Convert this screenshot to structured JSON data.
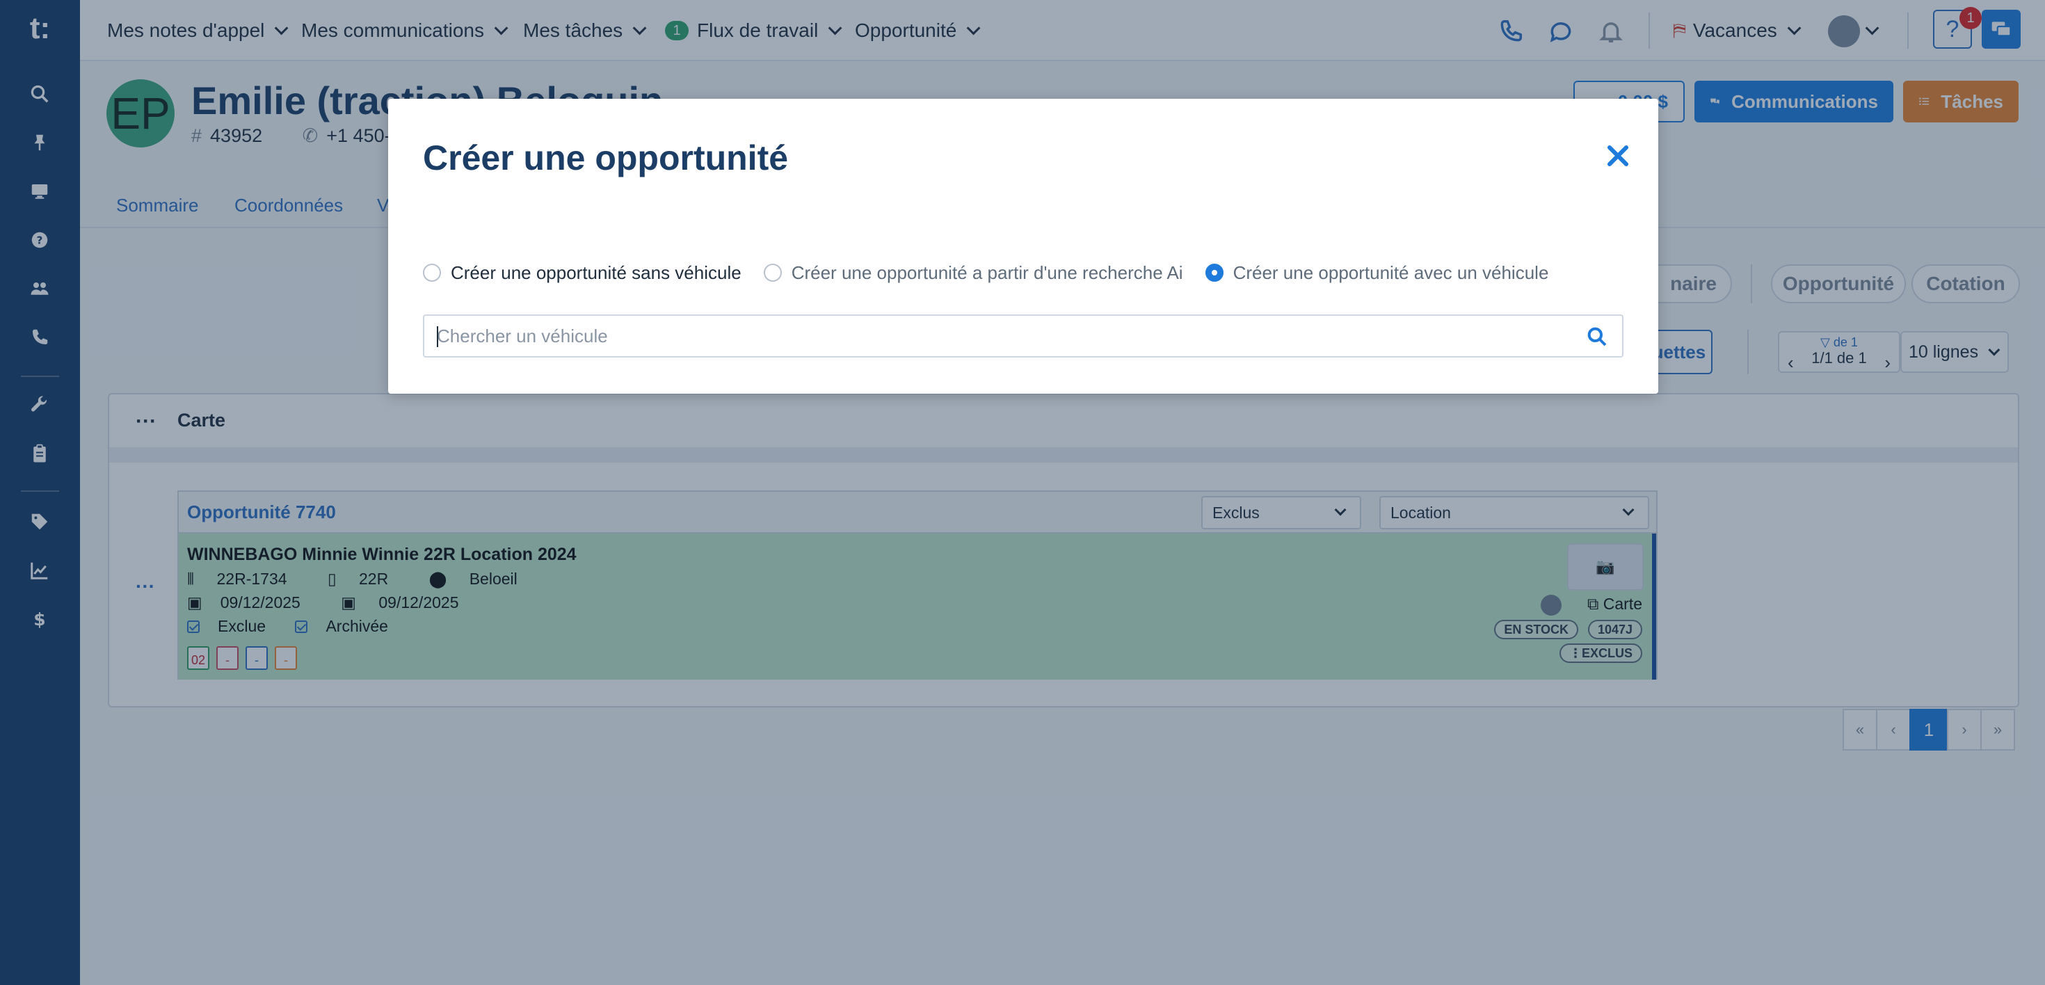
{
  "logo": "t:",
  "topnav": {
    "items": [
      {
        "label": "Mes notes d'appel"
      },
      {
        "label": "Mes communications"
      },
      {
        "label": "Mes tâches"
      },
      {
        "label": "Flux de travail",
        "badge": "1"
      },
      {
        "label": "Opportunité"
      }
    ],
    "dealership": "Vacances",
    "help_badge": "1"
  },
  "contact": {
    "initials": "EP",
    "name": "Emilie (traction) Beloquin",
    "id": "43952",
    "phone": "+1 450-",
    "balance": "0,00 $",
    "communications_label": "Communications",
    "tasks_label": "Tâches"
  },
  "tabs": [
    "Sommaire",
    "Coordonnées",
    "V"
  ],
  "pills": {
    "p1": "naire",
    "p2": "Opportunité",
    "p3": "Cotation"
  },
  "toolbar": {
    "etiquettes_label": "quettes",
    "filter_line": "de 1",
    "count": "1/1 de 1",
    "lines": "10 lignes"
  },
  "panel": {
    "title": "Carte",
    "opportunity": {
      "title": "Opportunité 7740",
      "status_select": "Exclus",
      "type_select": "Location",
      "vehicle_name": "WINNEBAGO Minnie Winnie 22R Location 2024",
      "stock": "22R-1734",
      "model": "22R",
      "location": "Beloeil",
      "date1": "09/12/2025",
      "date2": "09/12/2025",
      "chk1": "Exclue",
      "chk2": "Archivée",
      "cal_values": [
        "02",
        "-",
        "-",
        "-"
      ],
      "carte_link": "Carte",
      "tags": [
        "EN STOCK",
        "1047J",
        "EXCLUS"
      ]
    }
  },
  "pagination": [
    "«",
    "‹",
    "1",
    "›",
    "»"
  ],
  "modal": {
    "title": "Créer une opportunité",
    "options": [
      {
        "label": "Créer une opportunité sans véhicule",
        "selected": false
      },
      {
        "label": "Créer une opportunité a partir d'une recherche Ai",
        "selected": false
      },
      {
        "label": "Créer une opportunité avec un véhicule",
        "selected": true
      }
    ],
    "search_placeholder": "Chercher un véhicule"
  },
  "colors": {
    "sidebar": "#183b66",
    "accent": "#1e7bdb",
    "tasks": "#e8822e",
    "card_green": "#bfe7c9"
  }
}
